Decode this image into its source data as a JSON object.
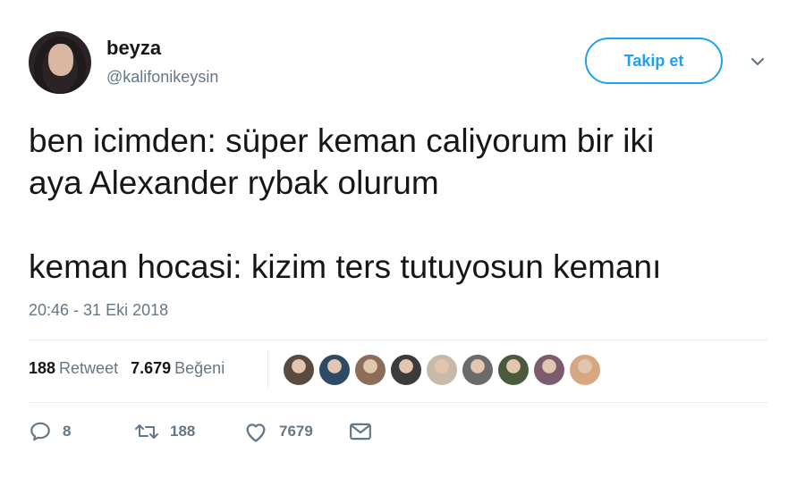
{
  "user": {
    "name": "beyza",
    "handle": "@kalifonikeysin"
  },
  "header": {
    "follow_label": "Takip et"
  },
  "tweet": {
    "text": "ben icimden: süper keman caliyorum bir iki\naya Alexander rybak olurum\n\nkeman hocasi: kizim ters tutuyosun kemanı",
    "timestamp": "20:46 - 31 Eki 2018"
  },
  "stats": {
    "retweet_count": "188",
    "retweet_label": "Retweet",
    "like_count": "7.679",
    "like_label": "Beğeni"
  },
  "liker_colors": [
    "#5a4a3f",
    "#2f4a66",
    "#8c6d5a",
    "#3b3b3b",
    "#c9b9a8",
    "#6b6b6b",
    "#4a5a3a",
    "#7d5b6e",
    "#d7a77f"
  ],
  "actions": {
    "reply_count": "8",
    "retweet_count": "188",
    "like_count": "7679"
  },
  "colors": {
    "accent": "#1da1f2",
    "muted": "#657786",
    "text": "#14171a"
  }
}
